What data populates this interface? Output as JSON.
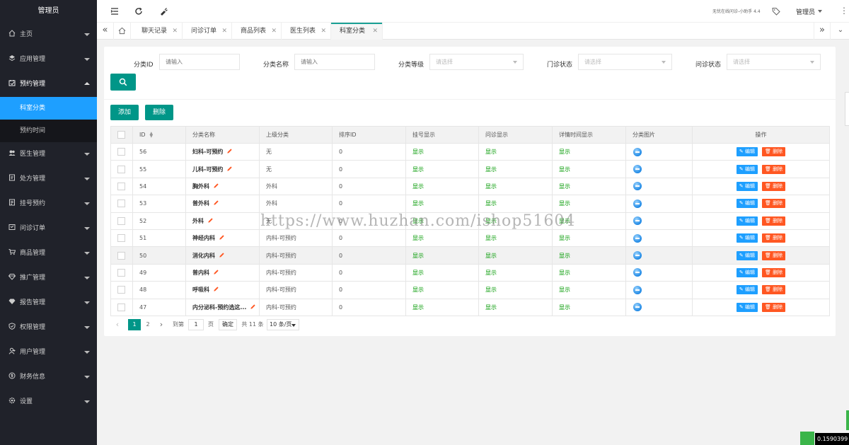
{
  "sidebar": {
    "brand": "管理员",
    "items": [
      {
        "label": "主页",
        "icon": "home-icon",
        "open": false
      },
      {
        "label": "应用管理",
        "icon": "layers-icon",
        "open": false
      },
      {
        "label": "预约管理",
        "icon": "calendar-icon",
        "open": true
      },
      {
        "label": "医生管理",
        "icon": "users-icon",
        "open": false
      },
      {
        "label": "处方管理",
        "icon": "prescription-icon",
        "open": false
      },
      {
        "label": "挂号预约",
        "icon": "register-icon",
        "open": false
      },
      {
        "label": "问诊订单",
        "icon": "order-icon",
        "open": false
      },
      {
        "label": "商品管理",
        "icon": "cart-icon",
        "open": false
      },
      {
        "label": "推广管理",
        "icon": "diamond-icon",
        "open": false
      },
      {
        "label": "报告管理",
        "icon": "report-icon",
        "open": false
      },
      {
        "label": "权限管理",
        "icon": "shield-icon",
        "open": false
      },
      {
        "label": "用户管理",
        "icon": "user-icon",
        "open": false
      },
      {
        "label": "财务信息",
        "icon": "finance-icon",
        "open": false
      },
      {
        "label": "设置",
        "icon": "gear-icon",
        "open": false
      }
    ],
    "subitems": [
      {
        "label": "科室分类",
        "active": true
      },
      {
        "label": "预约时间",
        "active": false
      }
    ]
  },
  "header": {
    "status_text": "无忧在线问诊-小助手 4.4",
    "user": "管理员",
    "more": "⋮"
  },
  "tabs": [
    {
      "label": "聊天记录",
      "active": false
    },
    {
      "label": "问诊订单",
      "active": false
    },
    {
      "label": "商品列表",
      "active": false
    },
    {
      "label": "医生列表",
      "active": false
    },
    {
      "label": "科室分类",
      "active": true
    }
  ],
  "filters": {
    "id_label": "分类ID",
    "id_placeholder": "请输入",
    "name_label": "分类名称",
    "name_placeholder": "请输入",
    "level_label": "分类等级",
    "level_placeholder": "请选择",
    "clinic_label": "门诊状态",
    "clinic_placeholder": "请选择",
    "consult_label": "问诊状态",
    "consult_placeholder": "请选择"
  },
  "actions": {
    "add": "添加",
    "delete": "删除"
  },
  "table": {
    "columns": [
      "ID",
      "分类名称",
      "上级分类",
      "排序ID",
      "挂号显示",
      "问诊显示",
      "详情时间显示",
      "分类图片",
      "操作"
    ],
    "edit_label": "编辑",
    "delete_label": "删除",
    "rows": [
      {
        "id": "56",
        "name": "妇科-可预约",
        "parent": "无",
        "sort": "0",
        "reg": "显示",
        "consult": "显示",
        "detail": "显示"
      },
      {
        "id": "55",
        "name": "儿科-可预约",
        "parent": "无",
        "sort": "0",
        "reg": "显示",
        "consult": "显示",
        "detail": "显示"
      },
      {
        "id": "54",
        "name": "胸外科",
        "parent": "外科",
        "sort": "0",
        "reg": "显示",
        "consult": "显示",
        "detail": "显示"
      },
      {
        "id": "53",
        "name": "普外科",
        "parent": "外科",
        "sort": "0",
        "reg": "显示",
        "consult": "显示",
        "detail": "显示"
      },
      {
        "id": "52",
        "name": "外科",
        "parent": "无",
        "sort": "0",
        "reg": "显示",
        "consult": "显示",
        "detail": "显示"
      },
      {
        "id": "51",
        "name": "神经内科",
        "parent": "内科-可预约",
        "sort": "0",
        "reg": "显示",
        "consult": "显示",
        "detail": "显示"
      },
      {
        "id": "50",
        "name": "消化内科",
        "parent": "内科-可预约",
        "sort": "0",
        "reg": "显示",
        "consult": "显示",
        "detail": "显示"
      },
      {
        "id": "49",
        "name": "普内科",
        "parent": "内科-可预约",
        "sort": "0",
        "reg": "显示",
        "consult": "显示",
        "detail": "显示"
      },
      {
        "id": "48",
        "name": "呼吸科",
        "parent": "内科-可预约",
        "sort": "0",
        "reg": "显示",
        "consult": "显示",
        "detail": "显示"
      },
      {
        "id": "47",
        "name": "内分泌科-预约选这...",
        "parent": "内科-可预约",
        "sort": "0",
        "reg": "显示",
        "consult": "显示",
        "detail": "显示"
      }
    ]
  },
  "pager": {
    "prev": "‹",
    "page1": "1",
    "page2": "2",
    "next": "›",
    "goto": "到第",
    "goto_value": "1",
    "page_unit": "页",
    "confirm": "确定",
    "total": "共 11 条",
    "per_page": "10 条/页"
  },
  "watermark": "https://www.huzhan.com/ishop51604",
  "fps": "0.1590399",
  "colors": {
    "sidebar_bg": "#20222a",
    "active_blue": "#1e9fff",
    "primary_green": "#009688",
    "danger": "#ff5722",
    "show_green": "#009900"
  }
}
